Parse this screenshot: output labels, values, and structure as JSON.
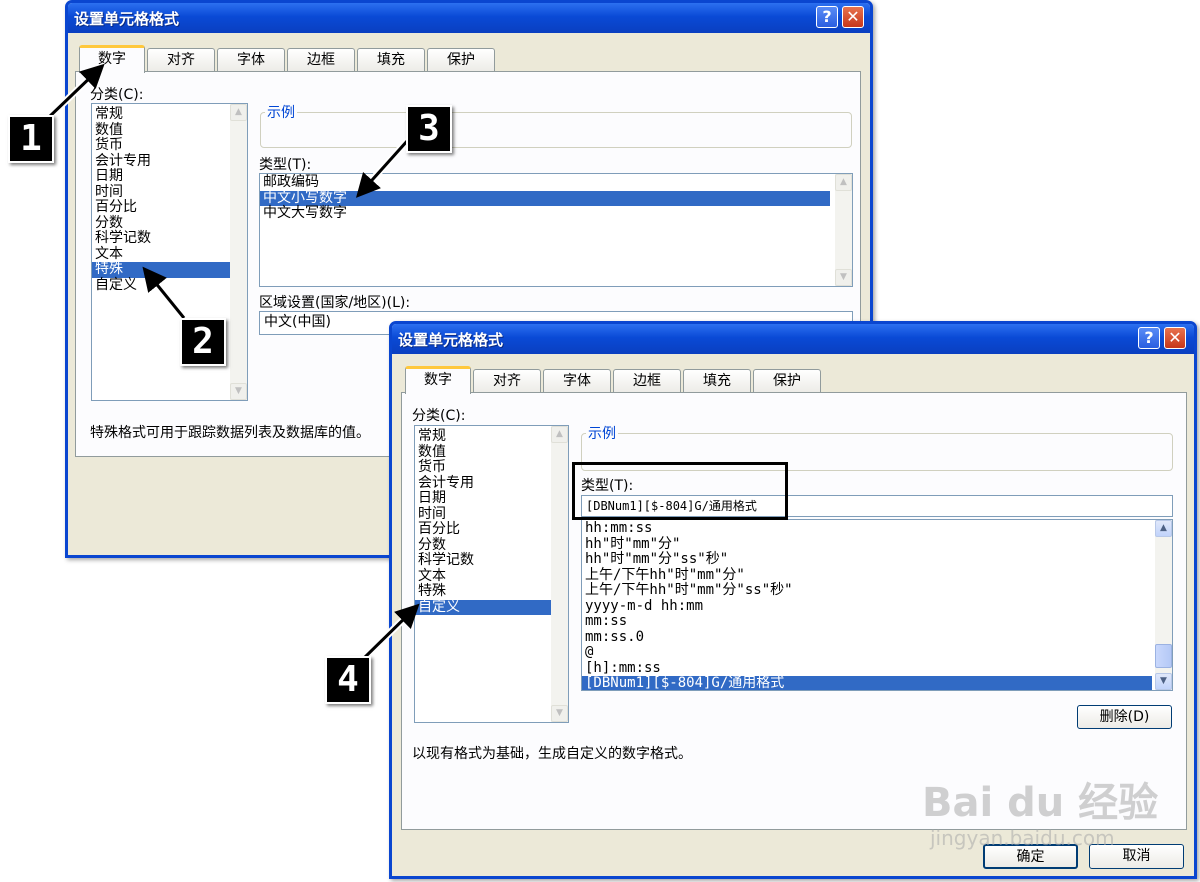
{
  "back_dialog": {
    "title": "设置单元格格式",
    "help_btn": "?",
    "close_btn": "✕",
    "tabs": [
      "数字",
      "对齐",
      "字体",
      "边框",
      "填充",
      "保护"
    ],
    "category_label": "分类(C):",
    "categories": [
      "常规",
      "数值",
      "货币",
      "会计专用",
      "日期",
      "时间",
      "百分比",
      "分数",
      "科学记数",
      "文本",
      "特殊",
      "自定义"
    ],
    "selected_category": "特殊",
    "sample_label": "示例",
    "type_label": "类型(T):",
    "types": [
      "邮政编码",
      "中文小写数字",
      "中文大写数字"
    ],
    "selected_type": "中文小写数字",
    "locale_label": "区域设置(国家/地区)(L):",
    "locale_value": "中文(中国)",
    "description": "特殊格式可用于跟踪数据列表及数据库的值。"
  },
  "front_dialog": {
    "title": "设置单元格格式",
    "help_btn": "?",
    "close_btn": "✕",
    "tabs": [
      "数字",
      "对齐",
      "字体",
      "边框",
      "填充",
      "保护"
    ],
    "category_label": "分类(C):",
    "categories": [
      "常规",
      "数值",
      "货币",
      "会计专用",
      "日期",
      "时间",
      "百分比",
      "分数",
      "科学记数",
      "文本",
      "特殊",
      "自定义"
    ],
    "selected_category": "自定义",
    "sample_label": "示例",
    "type_label": "类型(T):",
    "type_value": "[DBNum1][$-804]G/通用格式",
    "formats": [
      "hh:mm:ss",
      "hh\"时\"mm\"分\"",
      "hh\"时\"mm\"分\"ss\"秒\"",
      "上午/下午hh\"时\"mm\"分\"",
      "上午/下午hh\"时\"mm\"分\"ss\"秒\"",
      "yyyy-m-d hh:mm",
      "mm:ss",
      "mm:ss.0",
      "@",
      "[h]:mm:ss",
      "[DBNum1][$-804]G/通用格式"
    ],
    "selected_format": "[DBNum1][$-804]G/通用格式",
    "delete_button": "删除(D)",
    "description": "以现有格式为基础，生成自定义的数字格式。",
    "ok_button": "确定",
    "cancel_button": "取消"
  },
  "steps": [
    "1",
    "2",
    "3",
    "4"
  ],
  "watermark": {
    "brand": "Bai du 经验",
    "url": "jingyan.baidu.com"
  }
}
